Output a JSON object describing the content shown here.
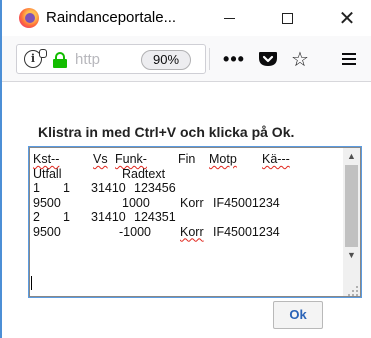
{
  "window": {
    "title": "Raindanceportale...",
    "minimize_icon": "minimize-icon",
    "maximize_icon": "maximize-icon",
    "close_glyph": "✕"
  },
  "toolbar": {
    "url_text": "http",
    "zoom": "90%",
    "more_glyph": "•••",
    "star_glyph": "☆",
    "icons": [
      "info-icon",
      "lock-icon",
      "page-actions-icon",
      "pocket-icon",
      "star-icon",
      "menu-icon"
    ],
    "lock_color": "#12bc00"
  },
  "dialog": {
    "instruction": "Klistra in med Ctrl+V och klicka på Ok.",
    "textarea": {
      "lines": [
        [
          {
            "text": "Kst--",
            "squiggle": true
          },
          {
            "text": "Vs",
            "squiggle": true
          },
          {
            "text": "Funk-",
            "squiggle": true
          },
          {
            "text": "Fin",
            "squiggle": false
          },
          {
            "text": "Motp",
            "squiggle": true
          },
          {
            "text": "Kä---",
            "squiggle": true
          }
        ],
        [
          {
            "text": "Utfall",
            "squiggle": false
          },
          {
            "text": "Radtext",
            "squiggle": false
          }
        ],
        [
          {
            "text": "1",
            "squiggle": false
          },
          {
            "text": "1",
            "squiggle": false
          },
          {
            "text": "31410",
            "squiggle": false
          },
          {
            "text": "123456",
            "squiggle": false
          }
        ],
        [
          {
            "text": "9500",
            "squiggle": false
          },
          {
            "text": "1000",
            "squiggle": false
          },
          {
            "text": "Korr",
            "squiggle": false
          },
          {
            "text": "IF45001234",
            "squiggle": false
          }
        ],
        [
          {
            "text": "2",
            "squiggle": false
          },
          {
            "text": "1",
            "squiggle": false
          },
          {
            "text": "31410",
            "squiggle": false
          },
          {
            "text": "124351",
            "squiggle": false
          }
        ],
        [
          {
            "text": "9500",
            "squiggle": false
          },
          {
            "text": "-1000",
            "squiggle": false
          },
          {
            "text": "Korr",
            "squiggle": true
          },
          {
            "text": "IF45001234",
            "squiggle": false
          }
        ]
      ]
    },
    "scroll_up_glyph": "▲",
    "scroll_down_glyph": "▼",
    "ok_label": "Ok"
  },
  "colors": {
    "focus_border": "#5b9be0",
    "ok_text": "#2a63b7",
    "spellcheck": "#e0261d"
  }
}
